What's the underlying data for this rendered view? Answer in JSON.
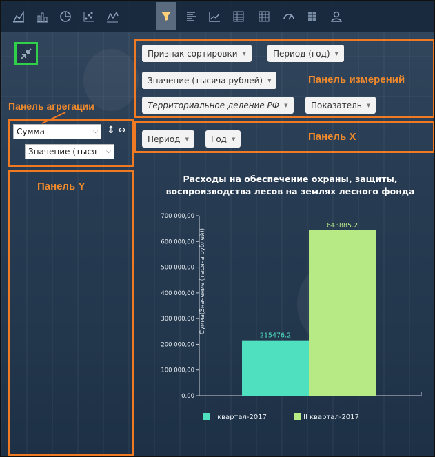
{
  "toolbar": {
    "icons": [
      "area-chart-icon",
      "bar-chart-icon",
      "pie-chart-icon",
      "scatter-chart-icon",
      "line-area-icon",
      "funnel-chart-icon",
      "stacked-bar-icon",
      "line-chart-icon",
      "table-chart-icon",
      "pivot-table-icon",
      "gauge-icon",
      "grid-table-icon",
      "user-icon"
    ],
    "active_index": 5
  },
  "dimensions": {
    "label": "Панель измерений",
    "chips": [
      "Признак сортировки",
      "Период (год)",
      "Значение (тысяча рублей)",
      "Территориальное деление РФ",
      "Показатель"
    ]
  },
  "aggregation": {
    "label": "Панель агрегации",
    "function": "Сумма",
    "field": "Значение (тыся"
  },
  "x_panel": {
    "label": "Панель X",
    "chips": [
      "Период",
      "Год"
    ]
  },
  "y_panel": {
    "label": "Панель Y"
  },
  "chart_data": {
    "type": "bar",
    "title_line1": "Расходы на обеспечение охраны, защиты,",
    "title_line2": "воспроизводства лесов на землях лесного фонда",
    "ylabel": "Сумма(Значение (тысяча рублей))",
    "ylim": [
      0,
      700000
    ],
    "yticks": [
      "0,00",
      "100 000,00",
      "200 000,00",
      "300 000,00",
      "400 000,00",
      "500 000,00",
      "600 000,00",
      "700 000,00"
    ],
    "series": [
      {
        "name": "I квартал-2017",
        "value": 215476.2,
        "label": "215476.2",
        "color": "#4fe0c0"
      },
      {
        "name": "II квартал-2017",
        "value": 643885.2,
        "label": "643885.2",
        "color": "#b7e985"
      }
    ]
  }
}
